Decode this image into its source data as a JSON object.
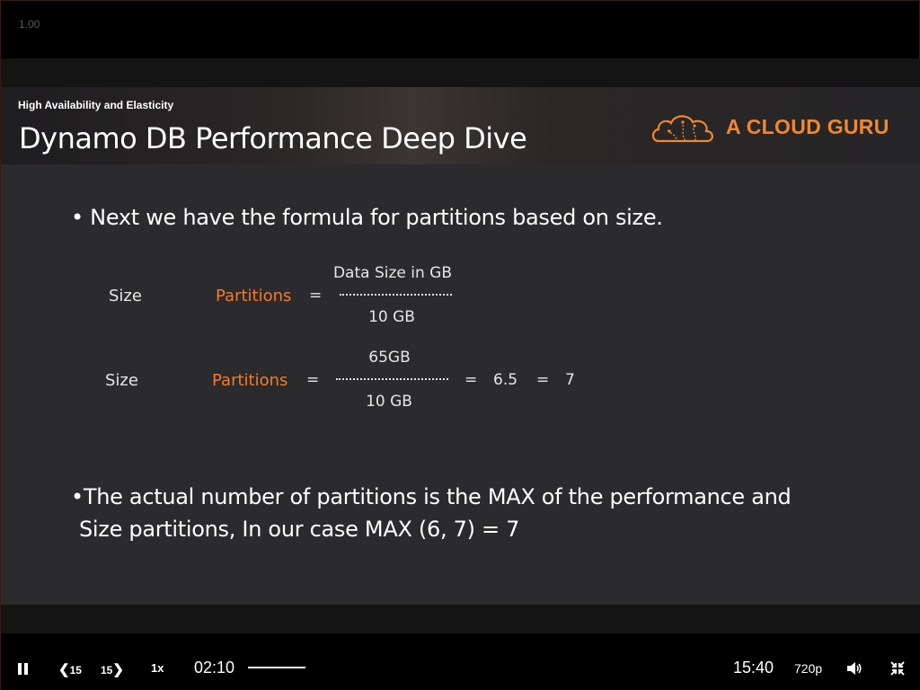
{
  "player": {
    "speed_indicator": "1.00"
  },
  "slide": {
    "subtitle": "High Availability and Elasticity",
    "title": "Dynamo DB Performance Deep Dive",
    "logo_text": "A CLOUD GURU",
    "bullet1": "• Next we have the formula for partitions based on size.",
    "formula1": {
      "label": "Size",
      "partitions": "Partitions",
      "equals": "=",
      "numerator": "Data Size in GB",
      "denominator": "10 GB"
    },
    "formula2": {
      "label": "Size",
      "partitions": "Partitions",
      "equals": "=",
      "numerator": "65GB",
      "denominator": "10 GB",
      "equals2": "=",
      "result": "6.5",
      "equals3": "=",
      "rounded": "7"
    },
    "bullet2_line1": "•The actual number of partitions is the MAX of the performance and",
    "bullet2_line2": "Size partitions, In our case MAX (6, 7) = 7"
  },
  "controls": {
    "back_label": "15",
    "forward_label": "15",
    "rate_label": "1x",
    "current_time": "02:10",
    "total_time": "15:40",
    "quality_label": "720p"
  },
  "colors": {
    "accent": "#f07c2e",
    "slide_bg": "#2b2a2c"
  }
}
